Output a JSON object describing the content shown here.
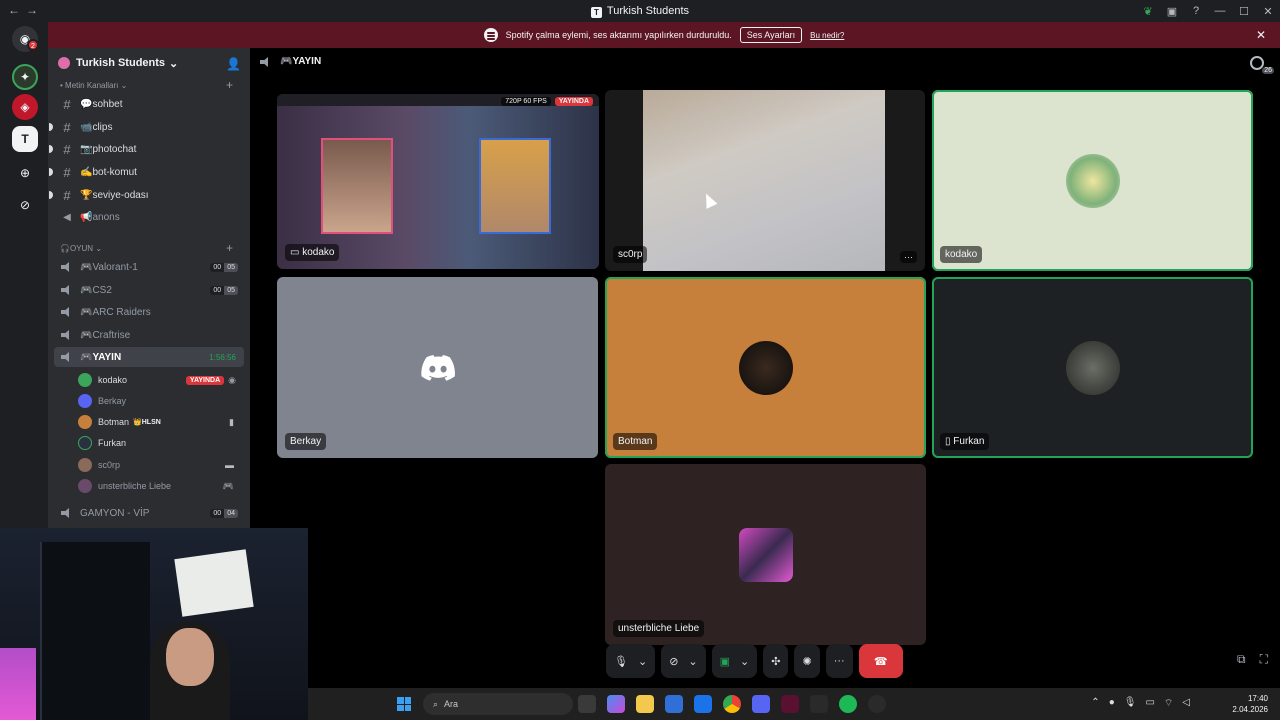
{
  "window": {
    "title": "Turkish Students"
  },
  "banner": {
    "message": "Spotify çalma eylemi, ses aktarımı yapılırken durduruldu.",
    "button": "Ses Ayarları",
    "link": "Bu nedir?",
    "close_icon": "close-icon"
  },
  "rail": {
    "dm_badge": "2",
    "server_letter": "T"
  },
  "server": {
    "name": "Turkish Students"
  },
  "channels": {
    "text_category": "Metin Kanalları",
    "text": [
      {
        "icon": "#",
        "name": "💬sohbet",
        "unread": false
      },
      {
        "icon": "#",
        "name": "📹clips",
        "unread": true
      },
      {
        "icon": "#",
        "name": "📷photochat",
        "unread": true
      },
      {
        "icon": "#",
        "name": "✍bot-komut",
        "unread": true
      },
      {
        "icon": "#",
        "name": "🏆seviye-odası",
        "unread": true
      },
      {
        "icon": "📢",
        "name": "📢anons",
        "unread": false
      }
    ],
    "voice_category": "OYUN",
    "voice": [
      {
        "name": "🎮Valorant-1",
        "c1": "00",
        "c2": "05"
      },
      {
        "name": "🎮CS2",
        "c1": "00",
        "c2": "05"
      },
      {
        "name": "🎮ARC Raiders"
      },
      {
        "name": "🎮Craftrise"
      }
    ],
    "active": {
      "name": "🎮YAYIN",
      "timer": "1:56:56"
    },
    "members": [
      {
        "name": "kodako",
        "live": "YAYINDA",
        "color": "#3ba55c"
      },
      {
        "name": "Berkay",
        "color": "#5865f2"
      },
      {
        "name": "Botman",
        "tag": "👑HLSN",
        "color": "#c77f3c"
      },
      {
        "name": "Furkan",
        "color": "#2a3040"
      },
      {
        "name": "sc0rp",
        "color": "#8a6a5a"
      },
      {
        "name": "unsterbliche Liebe",
        "color": "#6a4a6a"
      }
    ],
    "after": {
      "name": "GAMYON - VİP",
      "c1": "00",
      "c2": "04"
    }
  },
  "stage": {
    "channel": "🎮YAYIN",
    "viewer_count": "26",
    "tiles": {
      "stream": {
        "label": "kodako",
        "quality": "720P 60 FPS",
        "live": "YAYINDA"
      },
      "scorp": {
        "label": "sc0rp",
        "more": "···"
      },
      "kodako": {
        "label": "kodako"
      },
      "berkay": {
        "label": "Berkay"
      },
      "botman": {
        "label": "Botman"
      },
      "furkan": {
        "label": "Furkan"
      },
      "liebe": {
        "label": "unsterbliche Liebe"
      }
    }
  },
  "taskbar": {
    "search_placeholder": "Ara",
    "time": "17:40",
    "date": "2.04.2026"
  },
  "colors": {
    "accent": "#5865f2",
    "live": "#da373c",
    "speaking": "#23a559",
    "banner": "#5c1522"
  }
}
